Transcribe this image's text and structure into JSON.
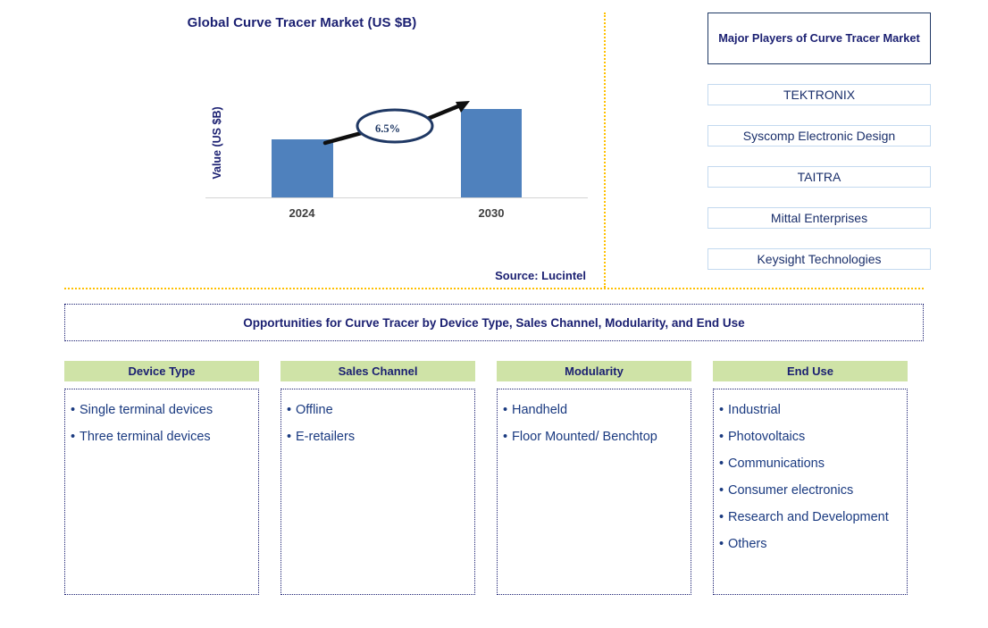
{
  "chart_panel": {
    "title": "Global Curve Tracer Market (US $B)",
    "y_axis_label": "Value (US $B)",
    "cagr_label": "6.5%",
    "source": "Source: Lucintel"
  },
  "chart_data": {
    "type": "bar",
    "title": "Global Curve Tracer Market (US $B)",
    "categories": [
      "2024",
      "2030"
    ],
    "values": [
      0.66,
      1.0
    ],
    "xlabel": "",
    "ylabel": "Value (US $B)",
    "ylim": [
      0,
      1.25
    ],
    "grid": false,
    "legend": "none",
    "bar_color": "#4F81BD",
    "annotations": [
      {
        "text": "6.5%",
        "type": "cagr-callout",
        "from": "2024",
        "to": "2030"
      }
    ]
  },
  "players": {
    "header": "Major Players of Curve Tracer Market",
    "items": [
      "TEKTRONIX",
      "Syscomp Electronic Design",
      "TAITRA",
      "Mittal Enterprises",
      "Keysight Technologies"
    ]
  },
  "opportunities": {
    "banner": "Opportunities for Curve Tracer by Device Type, Sales Channel, Modularity, and End Use",
    "columns": [
      {
        "header": "Device Type",
        "items": [
          "Single terminal devices",
          "Three terminal devices"
        ]
      },
      {
        "header": "Sales Channel",
        "items": [
          "Offline",
          "E-retailers"
        ]
      },
      {
        "header": "Modularity",
        "items": [
          "Handheld",
          "Floor Mounted/ Benchtop"
        ]
      },
      {
        "header": "End Use",
        "items": [
          "Industrial",
          "Photovoltaics",
          "Communications",
          "Consumer electronics",
          "Research and Development",
          "Others"
        ]
      }
    ]
  },
  "colors": {
    "navy": "#1a1f71",
    "bar_blue": "#4F81BD",
    "divider_orange": "#FFC000",
    "header_green": "#cfe3a7"
  }
}
